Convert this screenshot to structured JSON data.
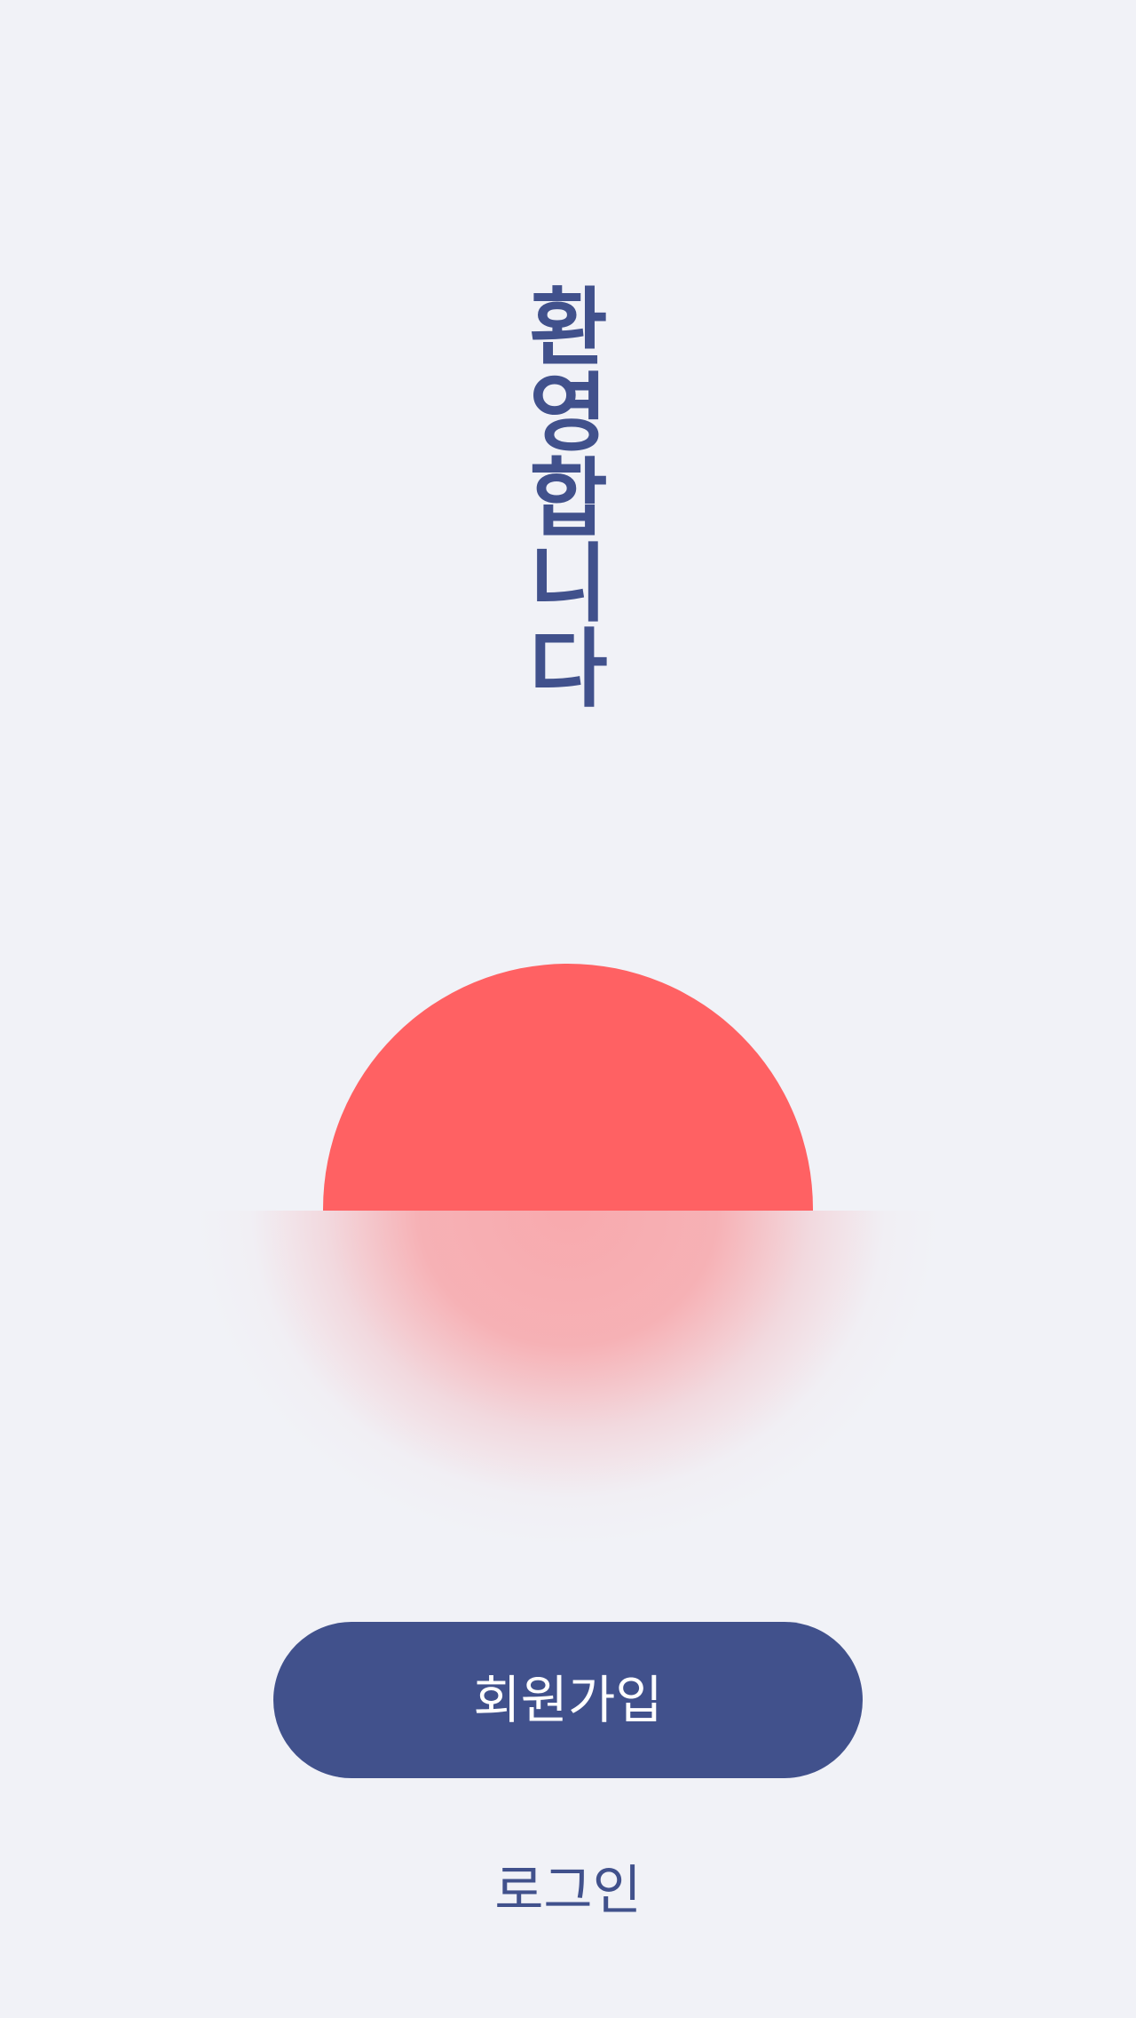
{
  "welcome": {
    "title": "환영합니다"
  },
  "actions": {
    "signup_label": "회원가입",
    "login_label": "로그인"
  },
  "colors": {
    "background": "#f1f2f7",
    "primary": "#41518c",
    "sun": "#ff6163",
    "sun_glow": "#f7aaae"
  }
}
